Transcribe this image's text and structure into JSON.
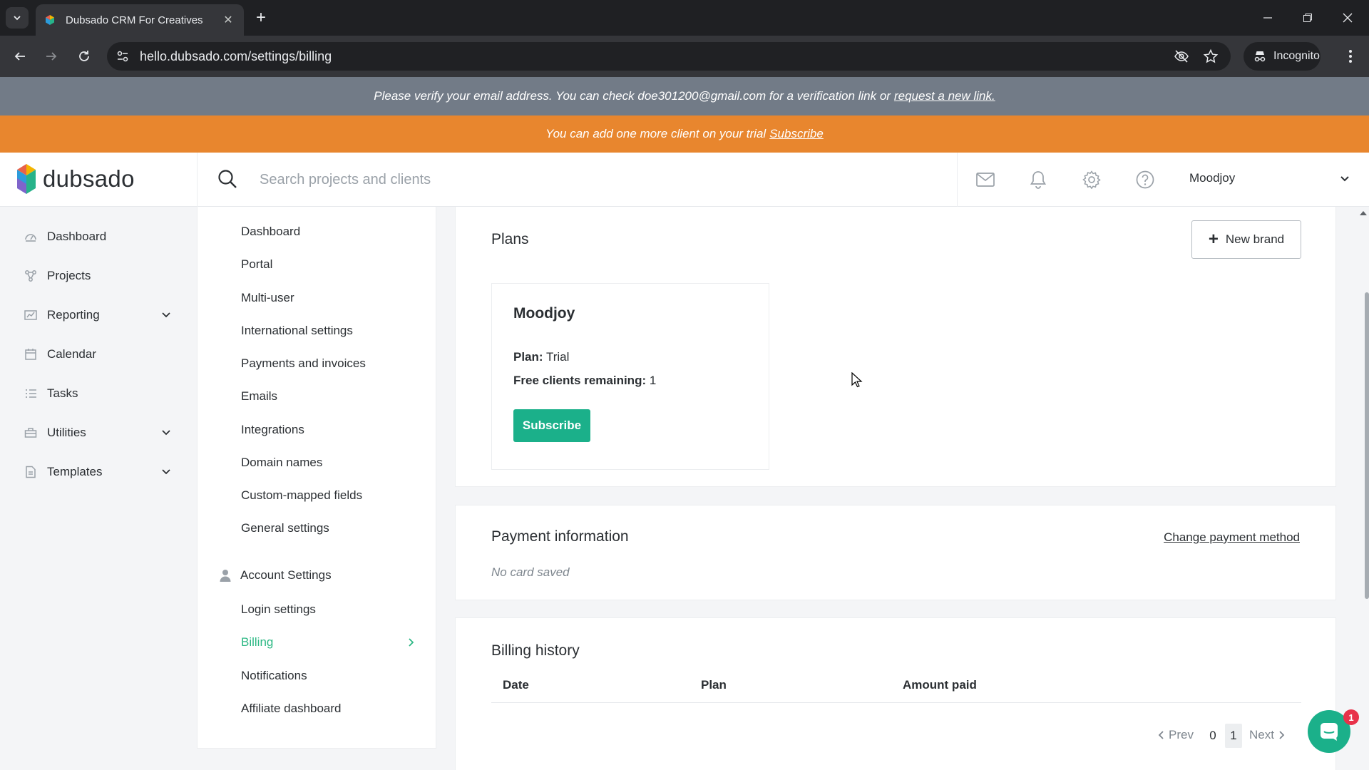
{
  "browser": {
    "tab_title": "Dubsado CRM For Creatives",
    "url": "hello.dubsado.com/settings/billing",
    "incognito_label": "Incognito"
  },
  "banners": {
    "verify_text": "Please verify your email address. You can check doe301200@gmail.com for a verification link or",
    "verify_link": "request a new link.",
    "trial_text": "You can add one more client on your trial",
    "trial_link": "Subscribe"
  },
  "header": {
    "logo_text": "dubsado",
    "search_placeholder": "Search projects and clients",
    "user_name": "Moodjoy"
  },
  "left_nav": [
    {
      "label": "Dashboard",
      "icon": "dashboard-icon"
    },
    {
      "label": "Projects",
      "icon": "projects-icon"
    },
    {
      "label": "Reporting",
      "icon": "reporting-icon"
    },
    {
      "label": "Calendar",
      "icon": "calendar-icon"
    },
    {
      "label": "Tasks",
      "icon": "tasks-icon"
    },
    {
      "label": "Utilities",
      "icon": "utilities-icon"
    },
    {
      "label": "Templates",
      "icon": "templates-icon"
    }
  ],
  "settings_menu": {
    "items": [
      "Dashboard",
      "Portal",
      "Multi-user",
      "International settings",
      "Payments and invoices",
      "Emails",
      "Integrations",
      "Domain names",
      "Custom-mapped fields",
      "General settings"
    ],
    "account_section": "Account Settings",
    "account_items": [
      "Login settings",
      "Billing",
      "Notifications",
      "Affiliate dashboard"
    ],
    "active_item": "Billing"
  },
  "plans": {
    "title": "Plans",
    "new_brand_label": "New brand",
    "brand_name": "Moodjoy",
    "plan_label": "Plan:",
    "plan_value": "Trial",
    "free_label": "Free clients remaining:",
    "free_value": "1",
    "subscribe_label": "Subscribe"
  },
  "payment": {
    "title": "Payment information",
    "change_label": "Change payment method",
    "no_card": "No card saved"
  },
  "billing": {
    "title": "Billing history",
    "columns": [
      "Date",
      "Plan",
      "Amount paid"
    ],
    "prev_label": "Prev",
    "next_label": "Next",
    "pages": [
      "0",
      "1"
    ],
    "current_page": "1"
  },
  "chat": {
    "badge": "1"
  },
  "colors": {
    "accent_green": "#1bb08a",
    "active_link": "#2cb884",
    "trial_banner": "#e8862e",
    "verify_banner": "#727b87",
    "badge_red": "#e8324a"
  }
}
